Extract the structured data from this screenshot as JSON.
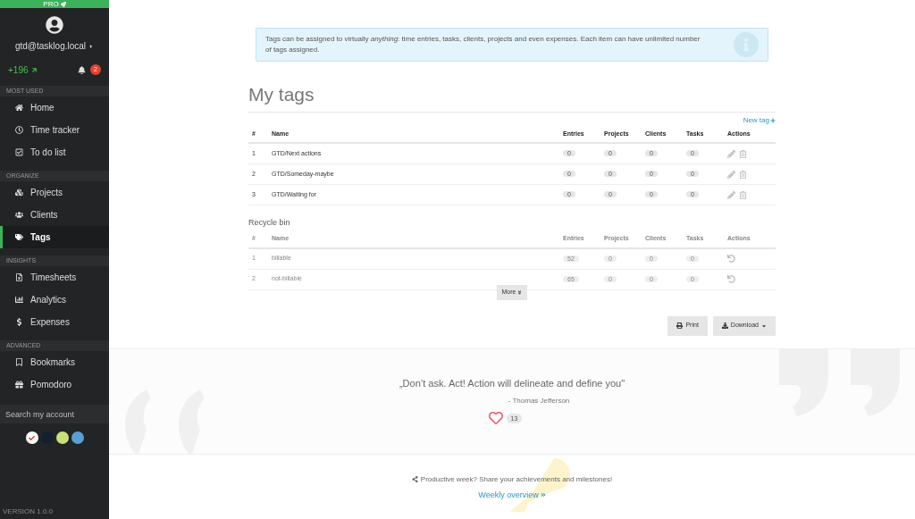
{
  "sidebar": {
    "plan": "PRO",
    "user": "gtd@tasklog.local",
    "score": "+196",
    "notifications": "2",
    "sections": [
      {
        "title": "MOST USED",
        "items": [
          {
            "label": "Home",
            "selected": false
          },
          {
            "label": "Time tracker",
            "selected": false
          },
          {
            "label": "To do list",
            "selected": false
          }
        ]
      },
      {
        "title": "ORGANIZE",
        "items": [
          {
            "label": "Projects",
            "selected": false
          },
          {
            "label": "Clients",
            "selected": false
          },
          {
            "label": "Tags",
            "selected": true
          }
        ]
      },
      {
        "title": "INSIGHTS",
        "items": [
          {
            "label": "Timesheets",
            "selected": false
          },
          {
            "label": "Analytics",
            "selected": false
          },
          {
            "label": "Expenses",
            "selected": false
          }
        ]
      },
      {
        "title": "ADVANCED",
        "items": [
          {
            "label": "Bookmarks",
            "selected": false
          },
          {
            "label": "Pomodoro",
            "selected": false
          }
        ]
      }
    ],
    "search": {
      "placeholder": "Search my account"
    },
    "themes": [
      {
        "color": "#ffffff",
        "selected": true
      },
      {
        "color": "#14202e",
        "selected": false
      },
      {
        "color": "#c8e07a",
        "selected": false
      },
      {
        "color": "#5a9fd4",
        "selected": false
      }
    ],
    "version": "VERSION 1.0.0"
  },
  "info": "Tags can be assigned to virtually *anything*: time entries, tasks, clients, projects and even expenses. Each item can have unlimited number of tags assigned.",
  "title": "My tags",
  "new_tag": "New tag",
  "tags_table": {
    "columns": [
      "#",
      "Name",
      "Entries",
      "Projects",
      "Clients",
      "Tasks",
      "Actions"
    ],
    "rows": [
      {
        "cells": [
          "1",
          "GTD/Next actions",
          "0",
          "0",
          "0",
          "0"
        ]
      },
      {
        "cells": [
          "2",
          "GTD/Someday-maybe",
          "0",
          "0",
          "0",
          "0"
        ]
      },
      {
        "cells": [
          "3",
          "GTD/Waiting for",
          "0",
          "0",
          "0",
          "0"
        ]
      }
    ]
  },
  "recycle_title": "Recycle bin",
  "recycle_table": {
    "columns": [
      "#",
      "Name",
      "Entries",
      "Projects",
      "Clients",
      "Tasks",
      "Actions"
    ],
    "rows": [
      {
        "cells": [
          "1",
          "billable",
          "52",
          "0",
          "0",
          "0"
        ]
      },
      {
        "cells": [
          "2",
          "not-billable",
          "65",
          "0",
          "0",
          "0"
        ]
      }
    ]
  },
  "more": "More",
  "buttons": {
    "print": "Print",
    "download": "Download"
  },
  "quote": {
    "text": "„Don’t ask. Act! Action will delineate and define you\"",
    "author": "- Thomas Jefferson",
    "likes": "13"
  },
  "share": {
    "text": "Productive week? Share your achievements and milestones!",
    "link": "Weekly overview"
  }
}
